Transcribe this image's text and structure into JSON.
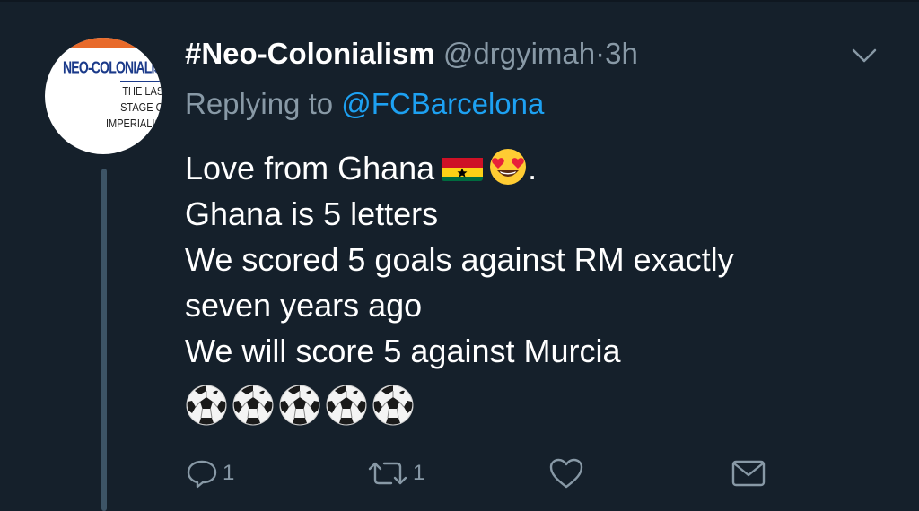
{
  "tweet": {
    "display_name": "#Neo-Colonialism",
    "handle": "@drgyimah",
    "separator": "·",
    "time": "3h",
    "replying_prefix": "Replying to",
    "replying_to": "@FCBarcelona",
    "lines": [
      "Love from Ghana",
      "Ghana is 5 letters",
      "We scored 5 goals against RM exactly",
      "seven years ago",
      "We will score 5 against Murcia"
    ],
    "line1_suffix": ".",
    "emojis": [
      "ghana-flag-emoji",
      "heart-eyes-emoji"
    ],
    "soccer_ball_count": 5
  },
  "avatar": {
    "logo_title": "NEO-COLONIALISM",
    "logo_lines": [
      "THE LAST",
      "STAGE OF",
      "IMPERIALISM"
    ]
  },
  "actions": {
    "reply_count": "1",
    "retweet_count": "1",
    "like_count": "",
    "dm_count": ""
  },
  "colors": {
    "background": "#15202b",
    "secondary_text": "#8899a6",
    "link": "#1da1f2",
    "primary_text": "#ffffff"
  }
}
